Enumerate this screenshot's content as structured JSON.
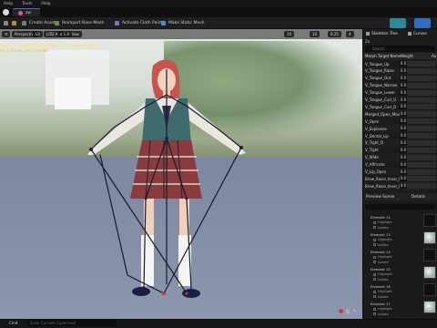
{
  "menu": {
    "items": [
      "Help",
      "Tools",
      "Help"
    ]
  },
  "tab": {
    "asset_name": "zw"
  },
  "toolbar": {
    "create_asset": "Create Asset",
    "reimport": "Reimport Base Mesh",
    "activate_cloth": "Activate Cloth Paint",
    "make_static": "Make Static Mesh"
  },
  "viewport": {
    "chip_perspective": "Perspective",
    "chip_lit": "Lit",
    "chip_lod": "LOD Auto",
    "chip_show": "Show",
    "chip_x1": "x 1.0",
    "warning": "ding the \"UsedWithMorphTargets\" in material editor.",
    "warning_sub": "ws_Cylinder_Sm_Cylinder",
    "num_a": "10",
    "num_b": "10",
    "num_c": "0.25",
    "num_d": "4"
  },
  "right_panel": {
    "tab_skeleton": "Skeleton Tree",
    "tab_curves": "Curves",
    "label_ze": "Ze",
    "search_placeholder": "Search",
    "header_name": "Morph Target Name",
    "header_weight": "Weight",
    "header_auto": "Au",
    "morph_targets": [
      {
        "name": "V_Tongue_Up",
        "weight": "0.0"
      },
      {
        "name": "V_Tongue_Raise",
        "weight": "0.0"
      },
      {
        "name": "V_Tongue_Out",
        "weight": "0.0"
      },
      {
        "name": "V_Tongue_Narrow",
        "weight": "0.0"
      },
      {
        "name": "V_Tongue_Lower",
        "weight": "0.0"
      },
      {
        "name": "V_Tongue_Curl_U",
        "weight": "0.0"
      },
      {
        "name": "V_Tongue_Curl_D",
        "weight": "0.0"
      },
      {
        "name": "Merged_Open_Mouth",
        "weight": "0.0"
      },
      {
        "name": "V_Open",
        "weight": "0.0"
      },
      {
        "name": "V_Explosive",
        "weight": "0.0"
      },
      {
        "name": "V_Dental_Lip",
        "weight": "0.0"
      },
      {
        "name": "V_Tight_O",
        "weight": "0.0"
      },
      {
        "name": "V_Tight",
        "weight": "0.0"
      },
      {
        "name": "V_Wide",
        "weight": "0.0"
      },
      {
        "name": "V_Affricate",
        "weight": "0.0"
      },
      {
        "name": "V_Lip_Open",
        "weight": "0.0"
      },
      {
        "name": "Brow_Raise_Inner_L",
        "weight": "0.0"
      },
      {
        "name": "Brow_Raise_Inner_R",
        "weight": "0.0"
      }
    ],
    "tab_preview": "Preview Scene",
    "tab_details": "Details",
    "elements": [
      {
        "label": "Element 12",
        "sub1": "Highlight",
        "sub2": "Isolate"
      },
      {
        "label": "Element 13",
        "sub1": "Highlight",
        "sub2": "Isolate"
      },
      {
        "label": "Element 14",
        "sub1": "Highlight",
        "sub2": "Isolate"
      },
      {
        "label": "Element 15",
        "sub1": "Highlight",
        "sub2": "Isolate"
      },
      {
        "label": "Element 16",
        "sub1": "Highlight",
        "sub2": "Isolate"
      },
      {
        "label": "Element 17",
        "sub1": "Highlight",
        "sub2": "Isolate"
      }
    ]
  },
  "status": {
    "cmd_label": "Cmd",
    "cmd_placeholder": "Enter Console Command"
  },
  "colors": {
    "accent": "#3d6fd6",
    "warning": "#ffe14a"
  }
}
